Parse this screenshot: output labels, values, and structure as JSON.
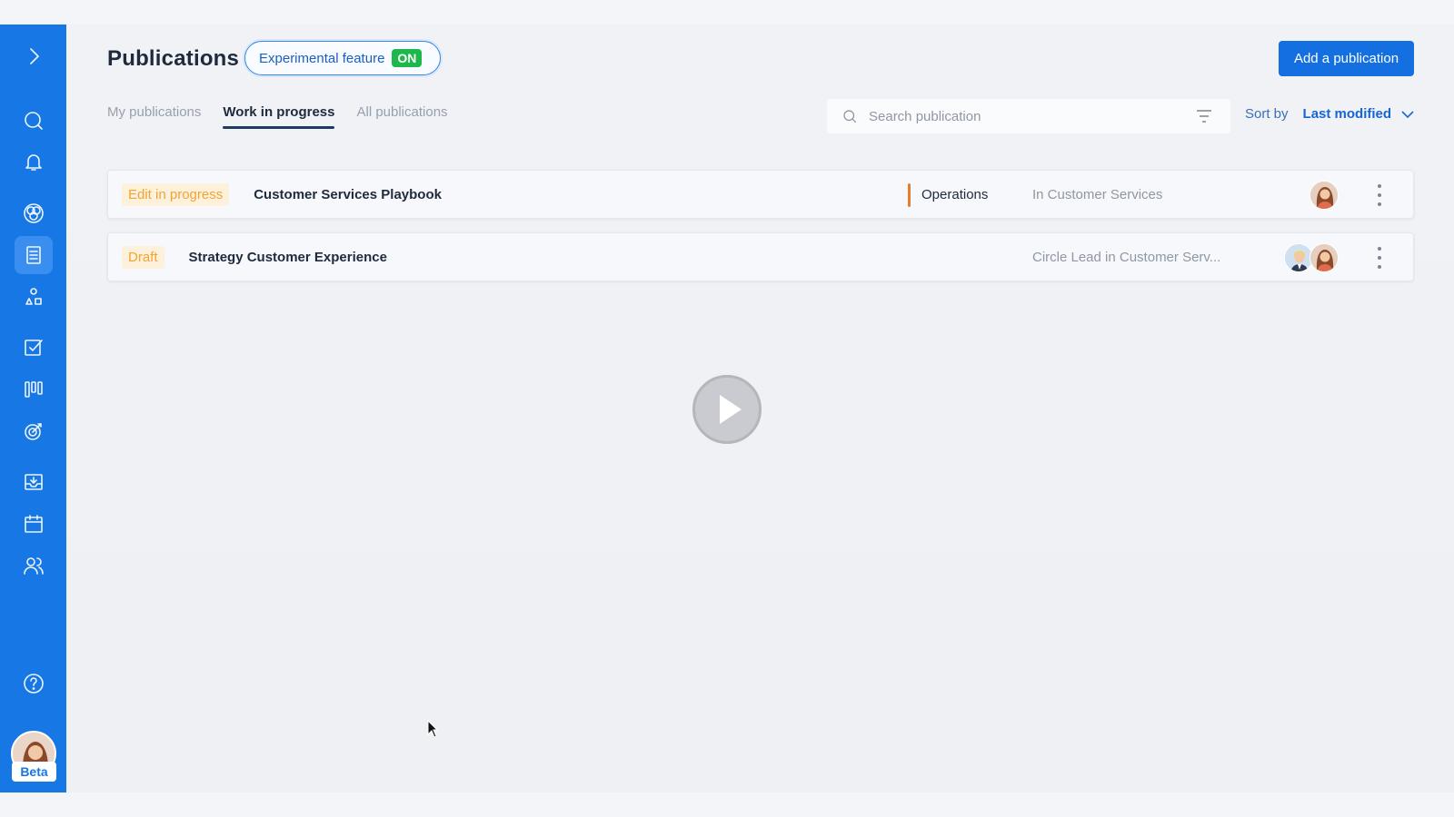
{
  "header": {
    "title": "Publications",
    "experimental_label": "Experimental feature",
    "experimental_state": "ON",
    "add_button": "Add a publication"
  },
  "tabs": [
    {
      "label": "My publications",
      "active": false
    },
    {
      "label": "Work in progress",
      "active": true
    },
    {
      "label": "All publications",
      "active": false
    }
  ],
  "search": {
    "placeholder": "Search publication"
  },
  "sort": {
    "label": "Sort by",
    "value": "Last modified"
  },
  "rows": [
    {
      "status": "Edit in progress",
      "title": "Customer Services Playbook",
      "circle": "Operations",
      "role": "In Customer Services"
    },
    {
      "status": "Draft",
      "title": "Strategy Customer Experience",
      "circle": "",
      "role": "Circle Lead in Customer Serv..."
    }
  ],
  "sidebar": {
    "items": [
      {
        "icon": "chevron-right-icon"
      },
      {
        "icon": "search-icon"
      },
      {
        "icon": "bell-icon"
      },
      {
        "icon": "circles-icon"
      },
      {
        "icon": "document-icon",
        "active": true
      },
      {
        "icon": "shapes-icon"
      },
      {
        "icon": "checkbox-icon"
      },
      {
        "icon": "kanban-icon"
      },
      {
        "icon": "target-icon"
      },
      {
        "icon": "inbox-icon"
      },
      {
        "icon": "calendar-icon"
      },
      {
        "icon": "people-icon"
      },
      {
        "icon": "help-icon"
      }
    ],
    "beta_label": "Beta"
  },
  "colors": {
    "sidebar": "#1677e5",
    "primary": "#1470e0",
    "on_badge": "#1db84b",
    "status_badge_text": "#efa535",
    "status_badge_bg": "#fdf1db",
    "circle_divider": "#e57d2e"
  }
}
